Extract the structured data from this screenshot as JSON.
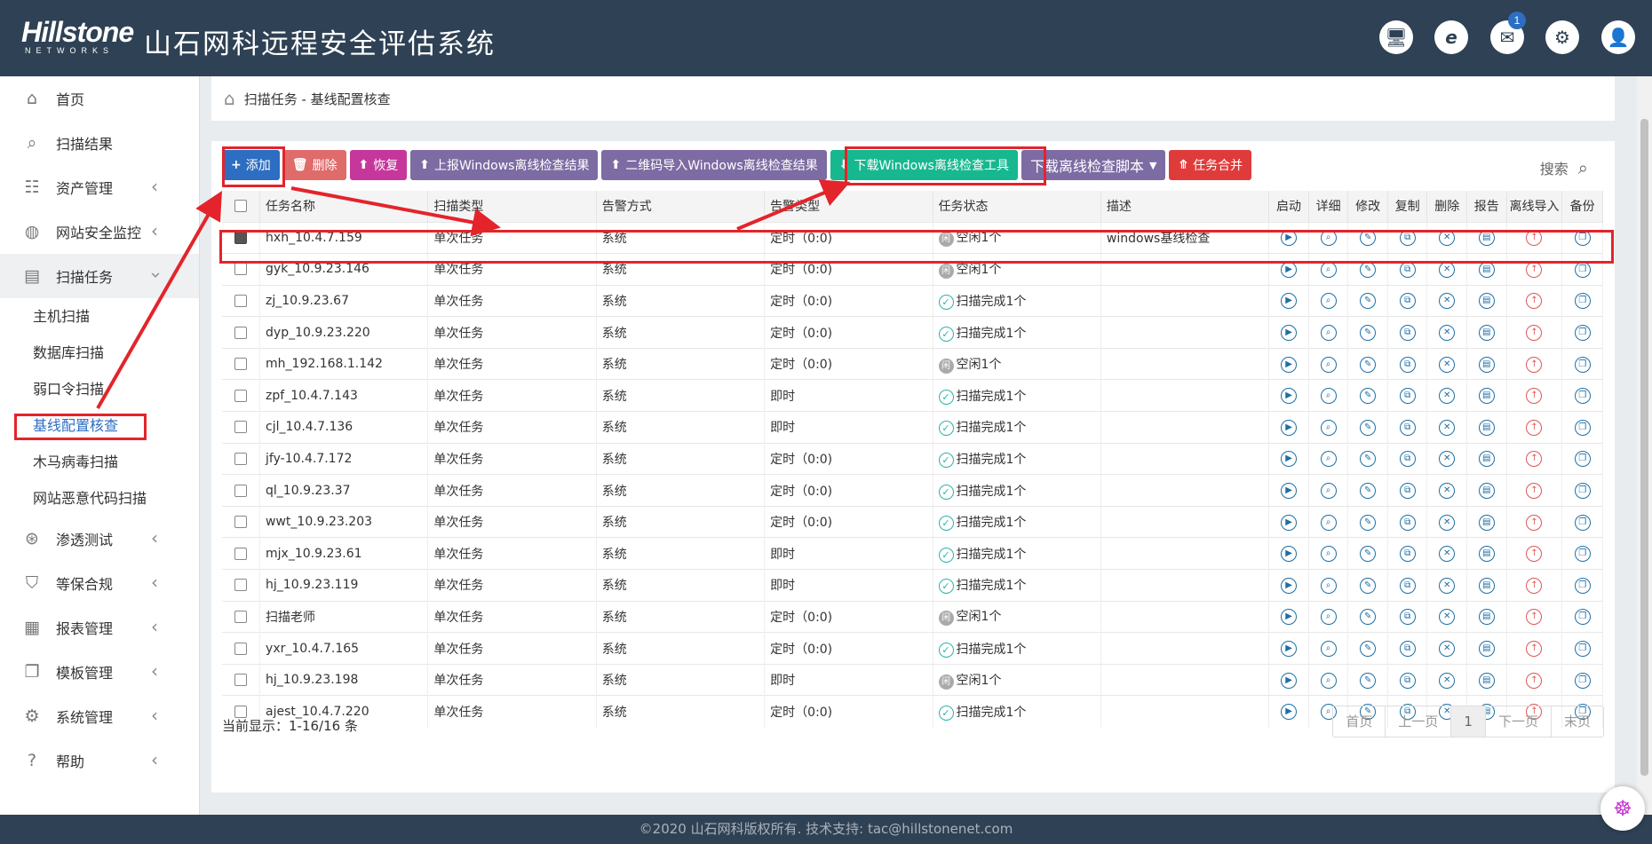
{
  "header": {
    "brand": "Hillstone",
    "brand_sub": "NETWORKS",
    "title": "山石网科远程安全评估系统",
    "icons": [
      "monitor-icon",
      "ie-icon",
      "mail-icon",
      "gear-icon",
      "user-icon"
    ],
    "mail_badge": "1"
  },
  "sidebar": {
    "items": [
      {
        "label": "首页",
        "icon": "home-icon"
      },
      {
        "label": "扫描结果",
        "icon": "search-icon"
      },
      {
        "label": "资产管理",
        "icon": "asset-icon"
      },
      {
        "label": "网站安全监控",
        "icon": "globe-icon"
      },
      {
        "label": "扫描任务",
        "icon": "scan-task-icon"
      },
      {
        "label": "渗透测试",
        "icon": "pentest-icon"
      },
      {
        "label": "等保合规",
        "icon": "shield-icon"
      },
      {
        "label": "报表管理",
        "icon": "report-icon"
      },
      {
        "label": "模板管理",
        "icon": "template-icon"
      },
      {
        "label": "系统管理",
        "icon": "gear-icon"
      },
      {
        "label": "帮助",
        "icon": "help-icon"
      }
    ],
    "sub_items": [
      "主机扫描",
      "数据库扫描",
      "弱口令扫描",
      "基线配置核查",
      "木马病毒扫描",
      "网站恶意代码扫描"
    ]
  },
  "breadcrumb": "扫描任务 - 基线配置核查",
  "toolbar": {
    "add": "添加",
    "delete": "删除",
    "restore": "恢复",
    "upload_offline": "上报Windows离线检查结果",
    "qr_import": "二维码导入Windows离线检查结果",
    "download_tool": "下载Windows离线检查工具",
    "download_script": "下载离线检查脚本",
    "merge": "任务合并",
    "search": "搜索"
  },
  "table": {
    "headers": [
      "任务名称",
      "扫描类型",
      "告警方式",
      "告警类型",
      "任务状态",
      "描述",
      "启动",
      "详细",
      "修改",
      "复制",
      "删除",
      "报告",
      "离线导入",
      "备份"
    ],
    "rows": [
      {
        "name": "hxh_10.4.7.159",
        "type": "单次任务",
        "alert": "系统",
        "alert_type": "定时（0:0)",
        "status": "空闲1个",
        "status_kind": "idle",
        "desc": "windows基线检查",
        "checked": true
      },
      {
        "name": "gyk_10.9.23.146",
        "type": "单次任务",
        "alert": "系统",
        "alert_type": "定时（0:0)",
        "status": "空闲1个",
        "status_kind": "idle",
        "desc": "",
        "checked": false
      },
      {
        "name": "zj_10.9.23.67",
        "type": "单次任务",
        "alert": "系统",
        "alert_type": "定时（0:0)",
        "status": "扫描完成1个",
        "status_kind": "done",
        "desc": "",
        "checked": false
      },
      {
        "name": "dyp_10.9.23.220",
        "type": "单次任务",
        "alert": "系统",
        "alert_type": "定时（0:0)",
        "status": "扫描完成1个",
        "status_kind": "done",
        "desc": "",
        "checked": false
      },
      {
        "name": "mh_192.168.1.142",
        "type": "单次任务",
        "alert": "系统",
        "alert_type": "定时（0:0)",
        "status": "空闲1个",
        "status_kind": "idle",
        "desc": "",
        "checked": false
      },
      {
        "name": "zpf_10.4.7.143",
        "type": "单次任务",
        "alert": "系统",
        "alert_type": "即时",
        "status": "扫描完成1个",
        "status_kind": "done",
        "desc": "",
        "checked": false
      },
      {
        "name": "cjl_10.4.7.136",
        "type": "单次任务",
        "alert": "系统",
        "alert_type": "即时",
        "status": "扫描完成1个",
        "status_kind": "done",
        "desc": "",
        "checked": false
      },
      {
        "name": "jfy-10.4.7.172",
        "type": "单次任务",
        "alert": "系统",
        "alert_type": "定时（0:0)",
        "status": "扫描完成1个",
        "status_kind": "done",
        "desc": "",
        "checked": false
      },
      {
        "name": "ql_10.9.23.37",
        "type": "单次任务",
        "alert": "系统",
        "alert_type": "定时（0:0)",
        "status": "扫描完成1个",
        "status_kind": "done",
        "desc": "",
        "checked": false
      },
      {
        "name": "wwt_10.9.23.203",
        "type": "单次任务",
        "alert": "系统",
        "alert_type": "定时（0:0)",
        "status": "扫描完成1个",
        "status_kind": "done",
        "desc": "",
        "checked": false
      },
      {
        "name": "mjx_10.9.23.61",
        "type": "单次任务",
        "alert": "系统",
        "alert_type": "即时",
        "status": "扫描完成1个",
        "status_kind": "done",
        "desc": "",
        "checked": false
      },
      {
        "name": "hj_10.9.23.119",
        "type": "单次任务",
        "alert": "系统",
        "alert_type": "即时",
        "status": "扫描完成1个",
        "status_kind": "done",
        "desc": "",
        "checked": false
      },
      {
        "name": "扫描老师",
        "type": "单次任务",
        "alert": "系统",
        "alert_type": "定时（0:0)",
        "status": "空闲1个",
        "status_kind": "idle",
        "desc": "",
        "checked": false
      },
      {
        "name": "yxr_10.4.7.165",
        "type": "单次任务",
        "alert": "系统",
        "alert_type": "定时（0:0)",
        "status": "扫描完成1个",
        "status_kind": "done",
        "desc": "",
        "checked": false
      },
      {
        "name": "hj_10.9.23.198",
        "type": "单次任务",
        "alert": "系统",
        "alert_type": "即时",
        "status": "空闲1个",
        "status_kind": "idle",
        "desc": "",
        "checked": false
      },
      {
        "name": "ajest_10.4.7.220",
        "type": "单次任务",
        "alert": "系统",
        "alert_type": "定时（0:0)",
        "status": "扫描完成1个",
        "status_kind": "done",
        "desc": "",
        "checked": false
      }
    ]
  },
  "footer": {
    "count": "当前显示：1-16/16 条",
    "pager": [
      "首页",
      "上一页",
      "1",
      "下一页",
      "末页"
    ],
    "copyright": "©2020 山石网科版权所有. 技术支持: tac@hillstonenet.com"
  },
  "colors": {
    "header_bg": "#2f4154",
    "annotation": "#e3242b",
    "add_btn": "#2d6ec2",
    "delete_btn": "#e06b6b",
    "restore_btn": "#c6379c",
    "purple_btn": "#7d6ba3",
    "download_btn": "#17b890",
    "merge_btn": "#e03b3b"
  }
}
